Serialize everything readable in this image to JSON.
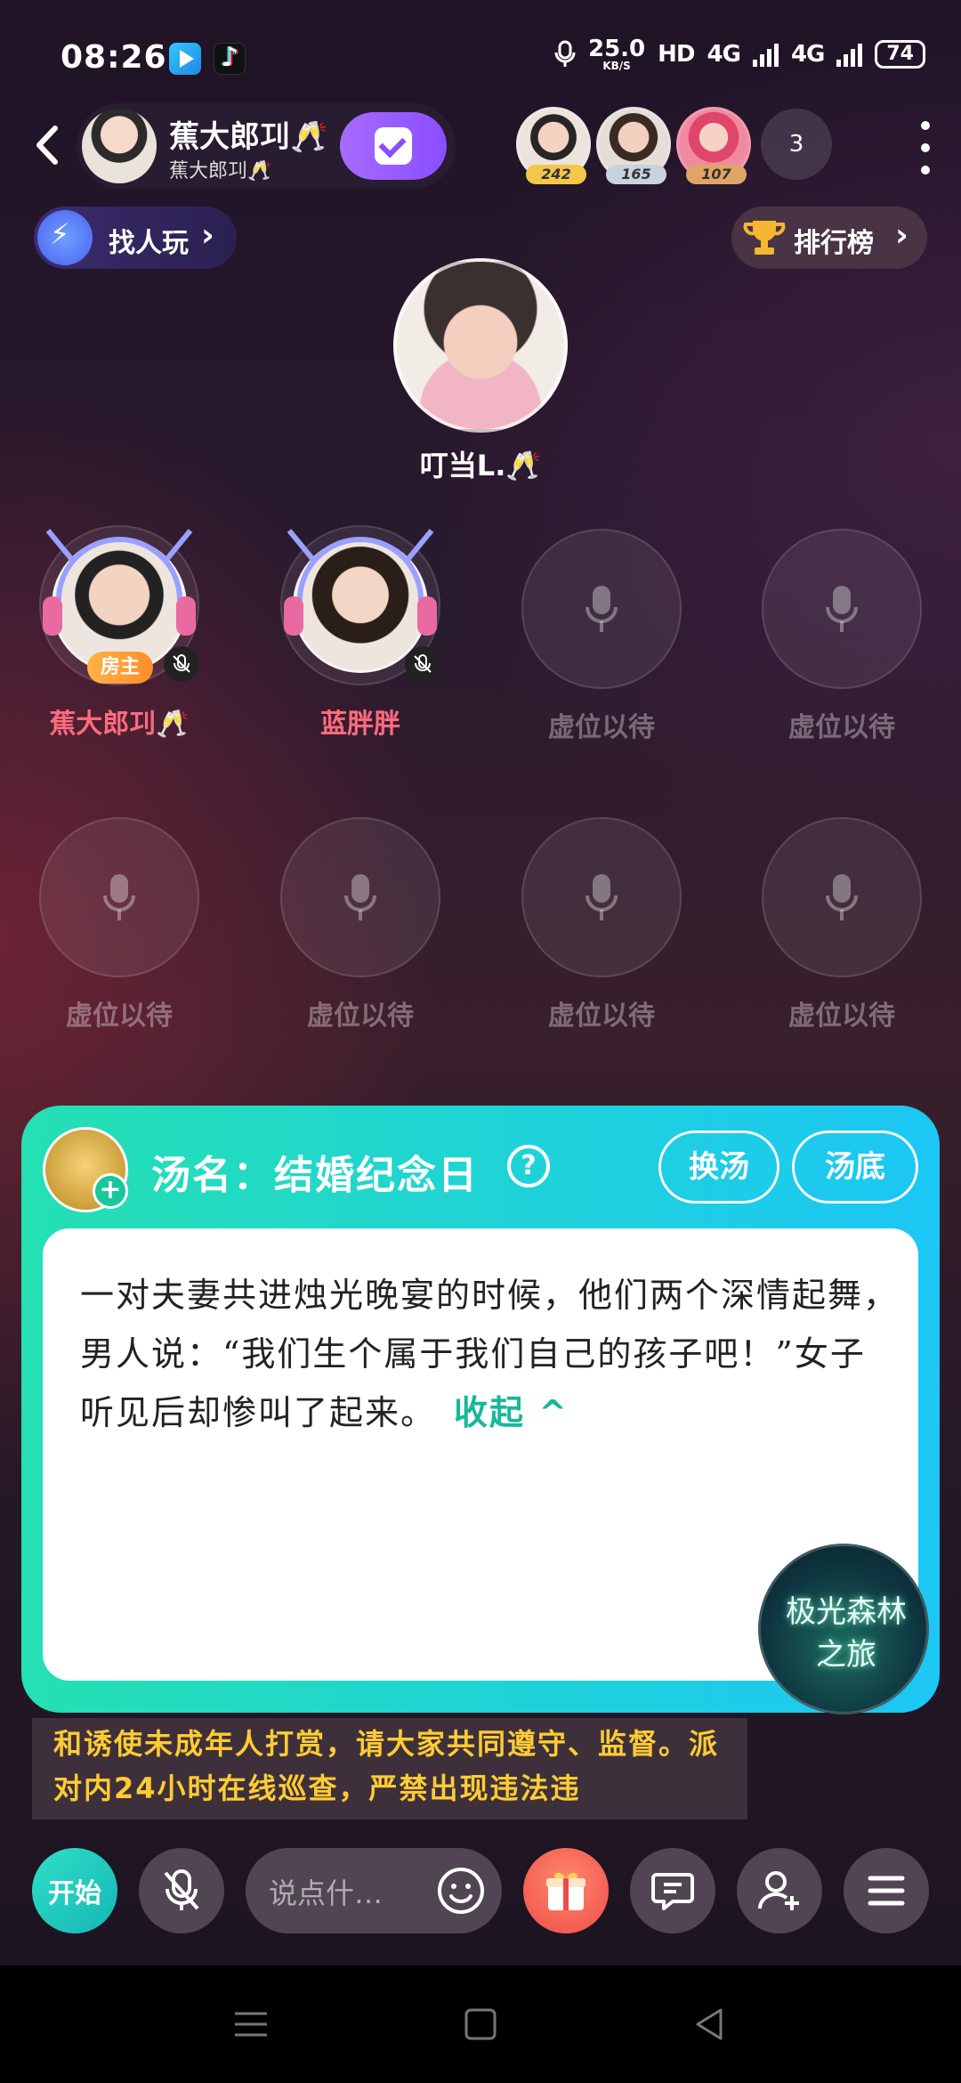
{
  "status_bar": {
    "time": "08:26",
    "speed_value": "25.0",
    "speed_unit": "KB/S",
    "hd": "HD",
    "net1": "4G",
    "net2": "4G",
    "battery": "74"
  },
  "header": {
    "room_name": "蕉大郎㓚🥂",
    "room_sub": "蕉大郎㓚🥂",
    "rank_badges": [
      "242",
      "165",
      "107"
    ],
    "viewer_count": "3"
  },
  "actions": {
    "find_players": "找人玩",
    "leaderboard": "排行榜"
  },
  "host": {
    "name": "叮当L.🥂"
  },
  "seats": [
    {
      "label": "蕉大郎㓚🥂",
      "occupied": true,
      "badge": "房主"
    },
    {
      "label": "蓝胖胖",
      "occupied": true,
      "badge": ""
    },
    {
      "label": "虚位以待",
      "occupied": false
    },
    {
      "label": "虚位以待",
      "occupied": false
    },
    {
      "label": "虚位以待",
      "occupied": false
    },
    {
      "label": "虚位以待",
      "occupied": false
    },
    {
      "label": "虚位以待",
      "occupied": false
    },
    {
      "label": "虚位以待",
      "occupied": false
    }
  ],
  "game_panel": {
    "title": "汤名：结婚纪念日",
    "swap_label": "换汤",
    "reveal_label": "汤底",
    "story": "一对夫妻共进烛光晚宴的时候，他们两个深情起舞，男人说：“我们生个属于我们自己的孩子吧！”女子听见后却惨叫了起来。",
    "collapse_label": "收起",
    "badge_line1": "极光森林",
    "badge_line2": "之旅"
  },
  "notice": {
    "text": "和诱使未成年人打赏，请大家共同遵守、监督。派对内24小时在线巡查，严禁出现违法违"
  },
  "toolbar": {
    "start_label": "开始",
    "chat_placeholder": "说点什…"
  },
  "colors": {
    "panel_accent": "#1fd2d8",
    "seat_name": "#ff6b7d",
    "notice_text": "#ffcc33",
    "check_button": "#8a4dff"
  }
}
